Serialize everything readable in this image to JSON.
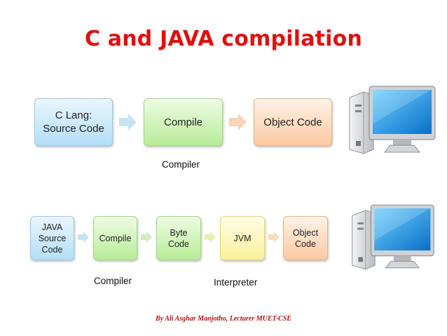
{
  "title": "C and JAVA compilation",
  "c_flow": {
    "source": "C Lang:\nSource Code",
    "compile": "Compile",
    "output": "Object Code",
    "tool_label": "Compiler"
  },
  "java_flow": {
    "source": "JAVA\nSource\nCode",
    "compile": "Compile",
    "bytecode": "Byte\nCode",
    "jvm": "JVM",
    "output": "Object\nCode",
    "compiler_label": "Compiler",
    "interpreter_label": "Interpreter"
  },
  "footer": "By Ali Asghar Manjotho, Lecturer MUET-CSE",
  "icons": [
    "computer-icon",
    "arrow-right-icon"
  ],
  "colors": {
    "title": "#e0100e",
    "blue": "#b3def7",
    "green": "#b8ec98",
    "orange": "#fcc9a2",
    "yellow": "#fbf09a",
    "footer": "#b01313"
  }
}
